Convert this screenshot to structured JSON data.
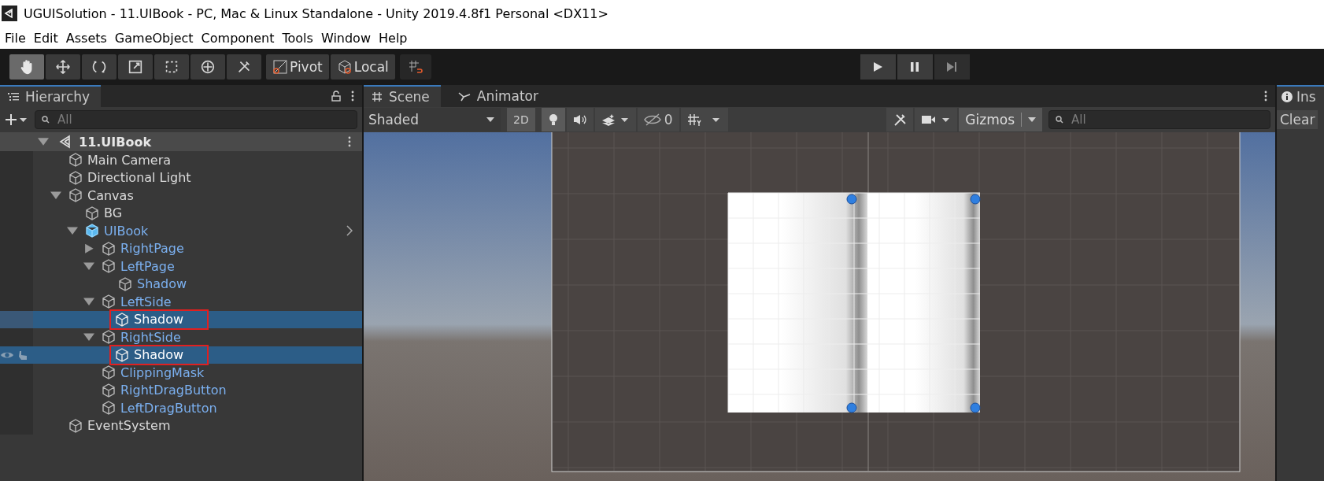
{
  "window": {
    "title": "UGUISolution - 11.UIBook - PC, Mac & Linux Standalone - Unity 2019.4.8f1 Personal <DX11>"
  },
  "menu": [
    "File",
    "Edit",
    "Assets",
    "GameObject",
    "Component",
    "Tools",
    "Window",
    "Help"
  ],
  "tools": [
    {
      "selected": true
    },
    {
      "selected": false
    },
    {
      "selected": false
    },
    {
      "selected": false
    },
    {
      "selected": false
    },
    {
      "selected": false
    },
    {
      "selected": false
    }
  ],
  "pivot_buttons": [
    "Pivot",
    "Local"
  ],
  "hierarchy": {
    "tab": "Hierarchy",
    "search_placeholder": "All",
    "scene": "11.UIBook",
    "items": [
      {
        "name": "Main Camera",
        "kind": "object",
        "selected": false
      },
      {
        "name": "Directional Light",
        "kind": "object",
        "selected": false
      },
      {
        "name": "Canvas",
        "kind": "object",
        "selected": false,
        "expanded": true,
        "children": [
          {
            "name": "BG",
            "kind": "object",
            "selected": false
          },
          {
            "name": "UIBook",
            "kind": "prefab_root",
            "selected": false,
            "expanded": true,
            "children": [
              {
                "name": "RightPage",
                "kind": "prefab",
                "selected": false,
                "expanded": false
              },
              {
                "name": "LeftPage",
                "kind": "prefab",
                "selected": false,
                "expanded": true,
                "children": [
                  {
                    "name": "Shadow",
                    "kind": "prefab",
                    "selected": false
                  }
                ]
              },
              {
                "name": "LeftSide",
                "kind": "prefab",
                "selected": false,
                "expanded": true,
                "children": [
                  {
                    "name": "Shadow",
                    "kind": "object",
                    "selected": true,
                    "highlighted": true
                  }
                ]
              },
              {
                "name": "RightSide",
                "kind": "prefab",
                "selected": false,
                "expanded": true,
                "children": [
                  {
                    "name": "Shadow",
                    "kind": "object",
                    "selected": true,
                    "highlighted": true,
                    "hovered": true
                  }
                ]
              },
              {
                "name": "ClippingMask",
                "kind": "prefab",
                "selected": false
              },
              {
                "name": "RightDragButton",
                "kind": "prefab",
                "selected": false
              },
              {
                "name": "LeftDragButton",
                "kind": "prefab",
                "selected": false
              }
            ]
          }
        ]
      },
      {
        "name": "EventSystem",
        "kind": "object",
        "selected": false
      }
    ]
  },
  "scene_tabs": [
    {
      "label": "Scene",
      "selected": true
    },
    {
      "label": "Animator",
      "selected": false
    }
  ],
  "scene_toolbar": {
    "shading": "Shaded",
    "mode_2d": "2D",
    "hidden_count": "0",
    "gizmos": "Gizmos",
    "search_placeholder": "All"
  },
  "inspector": {
    "tab": "Ins",
    "clear": "Clear"
  }
}
